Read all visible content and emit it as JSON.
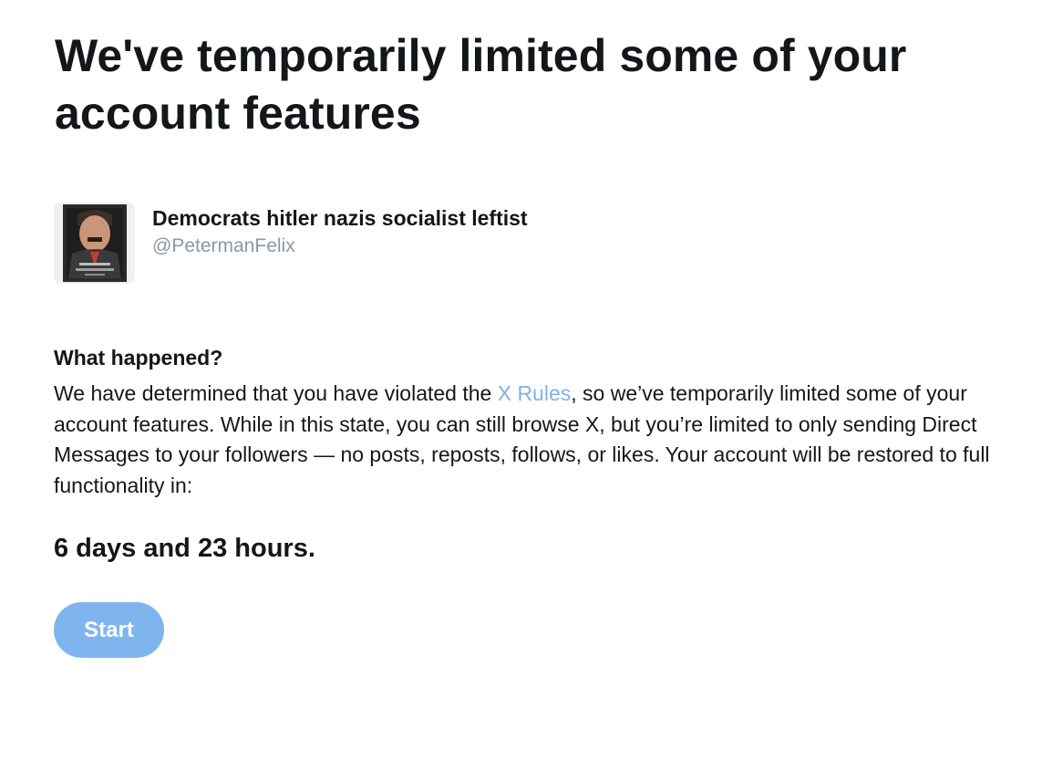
{
  "notice": {
    "heading": "We've temporarily limited some of your account features"
  },
  "account": {
    "display_name": "Democrats hitler nazis socialist leftist",
    "handle": "@PetermanFelix",
    "avatar_icon": "profile-photo"
  },
  "details": {
    "title": "What happened?",
    "text_before_link": "We have determined that you have violated the ",
    "link_text": "X Rules",
    "text_after_link": ", so we’ve temporarily limited some of your account features. While in this state, you can still browse X, but you’re limited to only sending Direct Messages to your followers — no posts, reposts, follows, or likes. Your account will be restored to full functionality in:",
    "duration": "6 days and 23 hours."
  },
  "actions": {
    "start_label": "Start"
  },
  "colors": {
    "text": "#14171a",
    "secondary_text": "#8899a6",
    "link": "#7fb1e8",
    "button_bg": "#7fb5ee",
    "button_text": "#ffffff"
  }
}
